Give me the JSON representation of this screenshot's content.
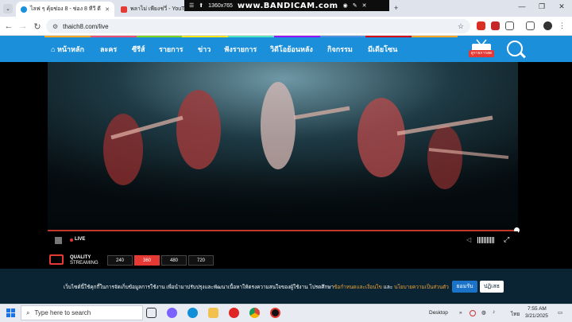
{
  "browser": {
    "tabs": [
      {
        "title": "ไลฟ ๆ คุ้ยช่อง 8 - ช่อง 8 ทีวี ดี",
        "active": true
      },
      {
        "title": "พลาไม่ เพียงช่วี่ - YouTube",
        "active": false
      }
    ],
    "tab_close_glyph": "✕",
    "new_tab_glyph": "+",
    "url": "thaich8.com/live",
    "window_controls": [
      "—",
      "❐",
      "✕"
    ]
  },
  "recorder": {
    "resolution": "1360x765",
    "brand": "www.BANDICAM.com"
  },
  "site_nav": {
    "items": [
      "หน้าหลัก",
      "ละคร",
      "ซีรีส์",
      "รายการ",
      "ข่าว",
      "ฟังรายการ",
      "วิดีโอย้อนหลัง",
      "กิจกรรม",
      "มีเดียโซน"
    ],
    "live_badge": "ดูรายการสด",
    "color_bar": [
      "#f5a623",
      "#e94e77",
      "#7ed321",
      "#f8e71c",
      "#50e3c2",
      "#9013fe",
      "#4a90e2",
      "#d0021b",
      "#f5a623"
    ]
  },
  "player": {
    "live_label": "LIVE",
    "progress_fraction": 1.0,
    "quality_title": "QUALITY",
    "quality_subtitle": "STREAMING",
    "quality_options": [
      "240",
      "360",
      "480",
      "720"
    ],
    "selected_quality": "360"
  },
  "cookie_bar": {
    "text_before": "เว็บไซต์นี้ใช้คุกกี้ในการจัดเก็บข้อมูลการใช้งาน เพื่อนำมาปรับปรุงและพัฒนาเนื้อหาให้ตรงความสนใจของผู้ใช้งาน โปรดศึกษา",
    "link1": "ข้อกำหนดและเงื่อนไข",
    "middle": " และ ",
    "link2": "นโยบายความเป็นส่วนตัว",
    "accept_label": "ยอมรับ",
    "decline_label": "ปฏิเสธ"
  },
  "taskbar": {
    "search_placeholder": "Type here to search",
    "desktop_label": "Desktop",
    "time": "7:55 AM",
    "date": "3/21/2025",
    "lang": "ไทย"
  },
  "colors": {
    "nav_blue": "#1c8fdb",
    "accent_red": "#e53935",
    "cookie_bg": "#0b2433"
  }
}
